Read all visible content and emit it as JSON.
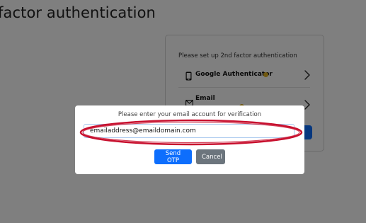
{
  "page": {
    "title": "factor authentication"
  },
  "setup_card": {
    "heading": "Please set up 2nd factor authentication",
    "methods": [
      {
        "label": "Google Authenticator",
        "icon": "phone-icon"
      },
      {
        "label": "Email",
        "icon": "envelope-icon"
      }
    ]
  },
  "modal": {
    "prompt": "Please enter your email account for verification",
    "email_value": "emailaddress@emaildomain.com",
    "send_label": "Send OTP",
    "cancel_label": "Cancel"
  },
  "colors": {
    "primary": "#0d6efd",
    "secondary": "#6c757d",
    "badge": "#e0b021",
    "highlight": "#c8102e",
    "overlay": "rgba(0,0,0,0.5)"
  }
}
